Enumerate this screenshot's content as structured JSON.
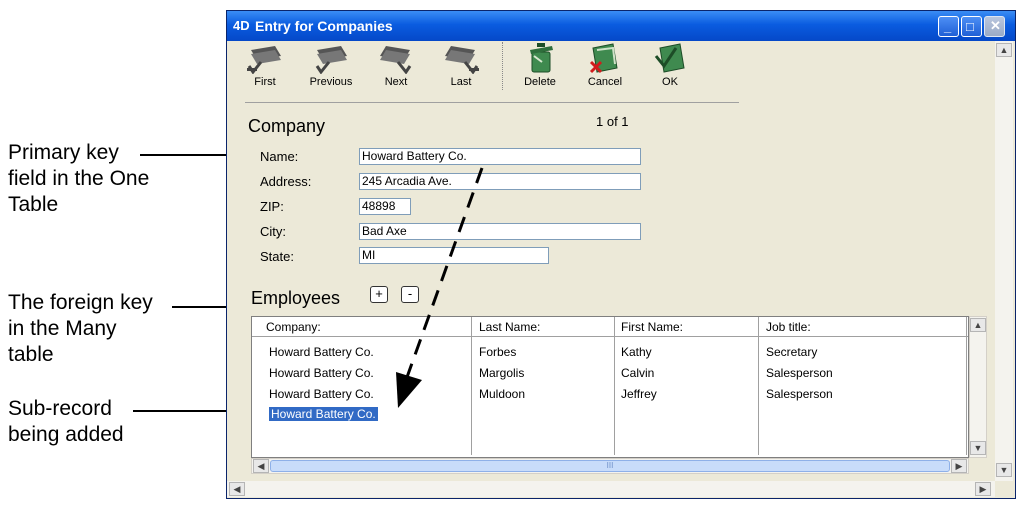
{
  "callouts": {
    "primary_key": [
      "Primary key",
      "field in the One",
      "Table"
    ],
    "foreign_key": [
      "The foreign key",
      "in the Many",
      "table"
    ],
    "sub_record": [
      "Sub-record",
      "being added"
    ]
  },
  "window": {
    "app_icon_text": "4D",
    "title": "Entry for Companies",
    "controls": [
      "minimize",
      "maximize",
      "close"
    ]
  },
  "toolbar": {
    "buttons": [
      {
        "label": "First",
        "icon": "first-record-icon"
      },
      {
        "label": "Previous",
        "icon": "previous-record-icon"
      },
      {
        "label": "Next",
        "icon": "next-record-icon"
      },
      {
        "label": "Last",
        "icon": "last-record-icon"
      },
      {
        "label": "Delete",
        "icon": "delete-trash-icon"
      },
      {
        "label": "Cancel",
        "icon": "cancel-folder-icon"
      },
      {
        "label": "OK",
        "icon": "ok-folder-icon"
      }
    ]
  },
  "form": {
    "section_title": "Company",
    "record_position": "1 of 1",
    "fields": [
      {
        "label": "Name:",
        "value": "Howard Battery Co."
      },
      {
        "label": "Address:",
        "value": "245 Arcadia Ave."
      },
      {
        "label": "ZIP:",
        "value": "48898"
      },
      {
        "label": "City:",
        "value": "Bad Axe"
      },
      {
        "label": "State:",
        "value": "MI"
      }
    ]
  },
  "employees": {
    "title": "Employees",
    "add_label": "+",
    "remove_label": "-",
    "columns": [
      "Company:",
      "Last Name:",
      "First Name:",
      "Job title:"
    ],
    "rows": [
      [
        "Howard Battery Co.",
        "Forbes",
        "Kathy",
        "Secretary"
      ],
      [
        "Howard Battery Co.",
        "Margolis",
        "Calvin",
        "Salesperson"
      ],
      [
        "Howard Battery Co.",
        "Muldoon",
        "Jeffrey",
        "Salesperson"
      ],
      [
        "Howard Battery Co.",
        "",
        "",
        ""
      ]
    ],
    "selected_row": 3
  },
  "colors": {
    "titlebar": "#0a5ce0",
    "window_bg": "#ece9d8",
    "selection": "#316ac5"
  }
}
